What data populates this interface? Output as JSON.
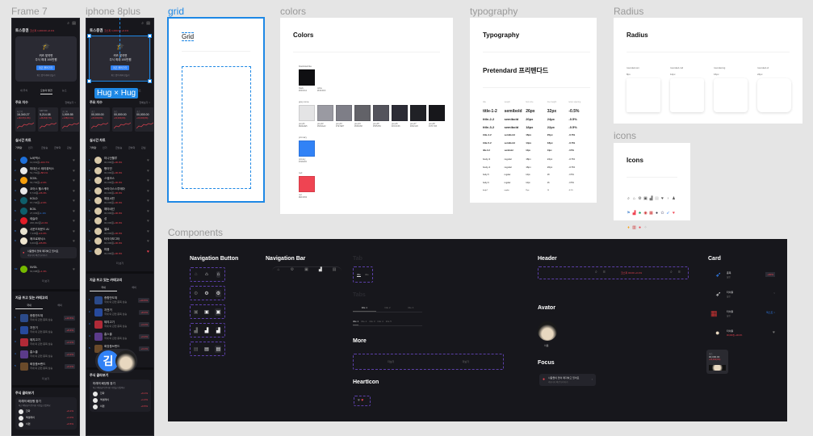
{
  "frames": {
    "frame7": "Frame 7",
    "iphone": "iphone 8plus",
    "grid": "grid",
    "colors": "colors",
    "typography": "typography",
    "radius": "Radius",
    "icons": "icons",
    "components": "Components"
  },
  "selection": {
    "size_label": "Hug × Hug",
    "color": "#1e88e5"
  },
  "phone": {
    "app_name": "토스증권",
    "ticker": "코스피 1,000.00 +0.1%",
    "banner": {
      "line1": "퀴즈 맞히면",
      "line2": "주식 최대 100만원",
      "button": "퀴즈 풀러가기",
      "sub": "퀴즈 없이 계좌 만들기"
    },
    "tabs": [
      "내 주식",
      "오늘의 발견",
      "뉴스"
    ],
    "index_title": "주요 지수",
    "see_all": "전체보기 >",
    "indices": [
      {
        "name": "나스닥",
        "value": "16,340.27",
        "change": "+163.97(1.0%)"
      },
      {
        "name": "S&P 500",
        "value": "5,214.08",
        "change": "+36.45(0.7%)"
      },
      {
        "name": "코스피",
        "value": "1,909.55",
        "change": "+1.88(0.1%)"
      }
    ],
    "indices2": [
      {
        "name": "코스",
        "value": "00,000.00",
        "change": "+00,000(0%)"
      },
      {
        "name": "코스",
        "value": "00,000.00",
        "change": "+00,000(0%)"
      },
      {
        "name": "코스",
        "value": "00,000.00",
        "change": "+00,000(0%)"
      }
    ],
    "chart_title": "실시간 차트",
    "chart_tabs": [
      "거래량",
      "인기",
      "급상승",
      "급하락",
      "관심"
    ],
    "stocks": [
      {
        "name": "노바백스",
        "price": "12,019원",
        "change": "+104.7%",
        "color": "#1e6fd9"
      },
      {
        "name": "마데슨스 테라퓨틱스",
        "price": "51,791원",
        "change": "+58.1%",
        "color": "#e8e8e8"
      },
      {
        "name": "SOXL",
        "price": "63,793원",
        "change": "+2.0%",
        "color": "#f59e0b"
      },
      {
        "name": "코어스 헬스케어",
        "price": "8,749원",
        "change": "+36.3%",
        "color": "#e8e8e8"
      },
      {
        "name": "KOLD",
        "price": "67,746원",
        "change": "+2.6%",
        "color": "#0f5e6b"
      },
      {
        "name": "BOIL",
        "price": "27,003원",
        "change": "-1.1%",
        "color": "#0f5e6b"
      },
      {
        "name": "테슬라",
        "price": "236,322원",
        "change": "+0.4%",
        "color": "#e11d27"
      },
      {
        "name": "사운드하운드 AI",
        "price": "7,448원",
        "change": "+14.0%",
        "color": "#e8e2d0"
      },
      {
        "name": "매크로제닉스",
        "price": "6,603원",
        "change": "+65.8%",
        "color": "#f0e6d0"
      },
      {
        "name": "NVDL",
        "price": "63,008원",
        "change": "+1.3%",
        "color": "#76b900"
      }
    ],
    "stocks2": [
      {
        "name": "미니언웰루",
        "price": "00,000원",
        "change": "+00.0%"
      },
      {
        "name": "빵이빈",
        "price": "00,000원",
        "change": "+00.0%"
      },
      {
        "name": "스템크스",
        "price": "00,000원",
        "change": "+00.0%"
      },
      {
        "name": "브라이스스투메아",
        "price": "00,000원",
        "change": "+00.0%"
      },
      {
        "name": "해호씨빈",
        "price": "00,000원",
        "change": "+00.0%"
      },
      {
        "name": "해야네선",
        "price": "00,000원",
        "change": "+00.0%"
      },
      {
        "name": "성",
        "price": "00,000원",
        "change": "+00.0%"
      },
      {
        "name": "밸로",
        "price": "00,000원",
        "change": "+00.0%"
      },
      {
        "name": "타이이모그터",
        "price": "00,000원",
        "change": "+00.0%"
      },
      {
        "name": "마음",
        "price": "00,000원",
        "change": "+00.0%"
      }
    ],
    "focus_banner": {
      "title": "사람들이 많이 매각하고 있어요",
      "sub": "커뮤니티 의견 보러가기"
    },
    "more": "더 보기",
    "category_title": "지금 뜨고 있는 카테고리",
    "category_tabs": [
      "국내",
      "해외"
    ],
    "categories": [
      {
        "name": "종합반도체",
        "sub": "국내 외 관련 종목 상승",
        "change": "+10.5%",
        "color": "#2b4a8a"
      },
      {
        "name": "자전거",
        "sub": "국내 외 관련 종목 상승",
        "change": "+8.4%",
        "color": "#274a9c"
      },
      {
        "name": "돼지고기",
        "sub": "국내 외 관련 종목 상승",
        "change": "+4.1%",
        "color": "#b02a37"
      },
      {
        "name": "홈스쿨",
        "sub": "국내 외 관련 종목 상승",
        "change": "+3.2%",
        "color": "#5b3b8a"
      },
      {
        "name": "화장품브랜드",
        "sub": "국내 외 관련 종목 상승",
        "change": "+3.1%",
        "color": "#6a4a2a"
      }
    ],
    "pick_title": "주식 골라보기",
    "pick_card": {
      "title": "미래의 배당왕 찾기",
      "sub": "최근 배당금이 증가한 기업을 모았어요"
    },
    "picks": [
      {
        "name": "한화",
        "change": "+9.1%"
      },
      {
        "name": "엑셀레이",
        "change": "+1.0%"
      },
      {
        "name": "이편",
        "change": "+0.5%"
      }
    ],
    "avatar_initial": "김"
  },
  "grid": {
    "title": "Grid"
  },
  "colors": {
    "title": "Colors",
    "groups": [
      {
        "label": "black&white",
        "items": [
          {
            "name": "black",
            "hex": "#0F0F12"
          },
          {
            "name": "white",
            "hex": "#FFFFFF"
          }
        ]
      },
      {
        "label": "grey tone",
        "items": [
          {
            "name": "grey01",
            "hex": "#E4E4E5"
          },
          {
            "name": "grey02",
            "hex": "#9A9AA2"
          },
          {
            "name": "grey03",
            "hex": "#7E7E87"
          },
          {
            "name": "grey04",
            "hex": "#626268"
          },
          {
            "name": "grey05",
            "hex": "#53535C"
          },
          {
            "name": "grey06",
            "hex": "#2C2C36"
          },
          {
            "name": "grey07",
            "hex": "#202126"
          },
          {
            "name": "grey08",
            "hex": "#17171B"
          }
        ]
      },
      {
        "label": "primary",
        "items": [
          {
            "name": "primary",
            "hex": "#3182F6"
          }
        ]
      },
      {
        "label": "red",
        "items": [
          {
            "name": "red",
            "hex": "#EF4452"
          }
        ]
      }
    ]
  },
  "typography": {
    "title": "Typography",
    "font": "Pretendard 프리텐다드",
    "headers": [
      "title",
      "weight",
      "font size",
      "line height",
      "letter spacing"
    ],
    "rows": [
      [
        "title-1-2",
        "semibold",
        "26px",
        "32px",
        "-0.5%"
      ],
      [
        "title-2-2",
        "semibold",
        "20px",
        "24px",
        "-0.5%"
      ],
      [
        "title-3-2",
        "semibold",
        "18px",
        "22px",
        "-0.5%"
      ],
      [
        "title-4-2",
        "semibold",
        "16px",
        "20px",
        "-0.5%"
      ],
      [
        "title-5-2",
        "semibold",
        "14px",
        "18px",
        "-0.5%"
      ],
      [
        "title-6-2",
        "semibold",
        "12px",
        "14px",
        "-0.5%"
      ],
      [
        "body-3",
        "regular",
        "18px",
        "22px",
        "-0.5%"
      ],
      [
        "body-4",
        "regular",
        "16px",
        "20px",
        "-0.5%"
      ],
      [
        "body-5",
        "regular",
        "14px",
        "18",
        "-0.5%"
      ],
      [
        "body-6",
        "regular",
        "12px",
        "16",
        "-0.5%"
      ],
      [
        "body-7",
        "regular",
        "11px",
        "14",
        "-0.5%"
      ]
    ]
  },
  "radius": {
    "title": "Radius",
    "items": [
      {
        "name": "rounded-sm",
        "value": "8px"
      },
      {
        "name": "rounded-md",
        "value": "12px"
      },
      {
        "name": "rounded-lg",
        "value": "16px"
      },
      {
        "name": "rounded-xl",
        "value": "24px"
      }
    ]
  },
  "icons": {
    "title": "Icons",
    "glyphs": [
      "search-icon",
      "home-icon",
      "gear-icon",
      "bag-icon",
      "chart-icon",
      "doc-icon",
      "heart-icon",
      "chevron-right-icon",
      "person-icon",
      "flag-icon",
      "chart-red-icon",
      "robot-icon",
      "flag-kr-icon",
      "flag-us-icon",
      "planet-icon",
      "rabbit-icon",
      "rocket-icon",
      "heart-red-icon",
      "bell-icon",
      "bars-icon",
      "apple-icon",
      "sparkle-icon"
    ]
  },
  "components": {
    "nav_button": "Navigation Button",
    "nav_bar": "Navigation Bar",
    "tab": "Tab",
    "tabs": "Tabs",
    "more": "More",
    "heart": "HeartIcon",
    "header": "Header",
    "avatar": "Avator",
    "focus": "Focus",
    "card": "Card",
    "tab_items": [
      "title",
      "title"
    ],
    "tabs3": [
      "title 1",
      "title 2",
      "title 3"
    ],
    "tabs5": [
      "title 1",
      "title 2",
      "title 3",
      "title 4",
      "title 5"
    ],
    "more_labels": [
      "더보기",
      "더보기"
    ],
    "header_ticker": "코스피 00.00 +0.1%",
    "avatar_name": "이름",
    "focus_text": "사람들이 많이 매각하고 있어요",
    "focus_sub": "커뮤니티 의견 보러가기",
    "card_rows": [
      {
        "name": "종목",
        "sub": "설명",
        "right": "+00%"
      },
      {
        "name": "타이틀",
        "sub": "설명",
        "right": ">"
      },
      {
        "name": "타이틀",
        "sub": "설명",
        "right": "텍스트 >"
      },
      {
        "name": "타이틀",
        "sub": "00,000원 +00.0%",
        "right": "♥"
      }
    ],
    "mini_card": {
      "label": "코스",
      "value": "00,000.00",
      "change": "+00,000(0%)"
    }
  }
}
